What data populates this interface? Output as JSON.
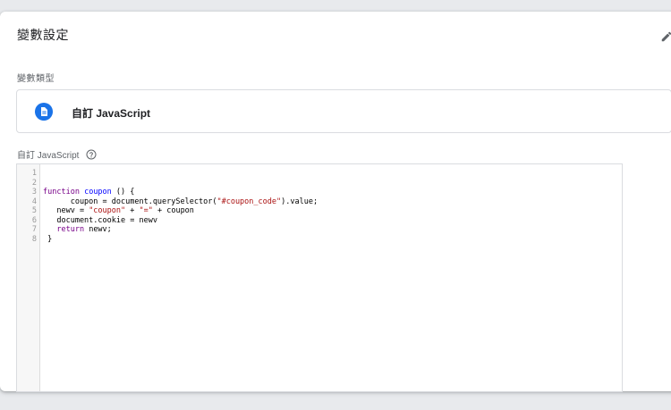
{
  "card": {
    "title": "變數設定",
    "type_section_label": "變數類型",
    "variable_type": "自訂 JavaScript",
    "editor_label": "自訂 JavaScript"
  },
  "icons": {
    "edit": "pencil-icon",
    "type": "document-icon",
    "help": "help-circle-icon"
  },
  "colors": {
    "type_icon_blue": "#1a73e8",
    "keyword": "#770088",
    "function_name": "#0000ff",
    "string": "#aa1111"
  },
  "editor": {
    "line_numbers": [
      "1",
      "2",
      "3",
      "4",
      "5",
      "6",
      "7",
      "8"
    ],
    "lines": [
      [],
      [],
      [
        {
          "t": "function",
          "c": "kw"
        },
        {
          "t": " "
        },
        {
          "t": "coupon",
          "c": "fn"
        },
        {
          "t": " () {"
        }
      ],
      [
        {
          "t": "      coupon = document.querySelector("
        },
        {
          "t": "\"#coupon_code\"",
          "c": "str"
        },
        {
          "t": ").value;"
        }
      ],
      [
        {
          "t": "   newv = "
        },
        {
          "t": "\"coupon\"",
          "c": "str"
        },
        {
          "t": " + "
        },
        {
          "t": "\"=\"",
          "c": "str"
        },
        {
          "t": " + coupon"
        }
      ],
      [
        {
          "t": "   document.cookie = newv"
        }
      ],
      [
        {
          "t": "   "
        },
        {
          "t": "return",
          "c": "kw"
        },
        {
          "t": " newv;"
        }
      ],
      [
        {
          "t": " }"
        }
      ]
    ]
  }
}
